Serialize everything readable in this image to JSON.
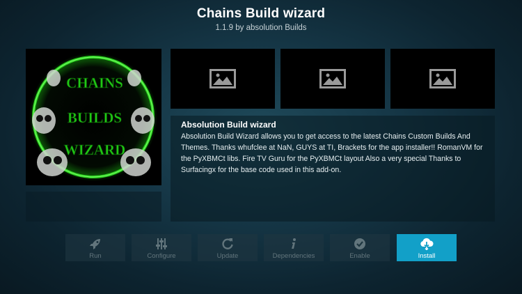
{
  "header": {
    "title": "Chains Build wizard",
    "subtitle": "1.1.9 by absolution Builds"
  },
  "addon_icon": {
    "icon": "chains-builds-wizard-logo",
    "lines": [
      "CHAINS",
      "BUILDS",
      "WIZARD"
    ],
    "accent": "#2bd81f"
  },
  "screenshots": [
    {
      "icon": "image-placeholder-icon"
    },
    {
      "icon": "image-placeholder-icon"
    },
    {
      "icon": "image-placeholder-icon"
    }
  ],
  "description": {
    "title": "Absolution Build wizard",
    "body": "Absolution Build Wizard allows you to get access to the latest Chains Custom Builds And Themes. Thanks whufclee at NaN, GUYS at TI, Brackets for the app installer!! RomanVM for the PyXBMCt libs. Fire TV Guru for the PyXBMCt layout Also a very special Thanks to Surfacingx for the base code used in this add-on."
  },
  "buttons": [
    {
      "label": "Run",
      "icon": "rocket-icon",
      "enabled": false
    },
    {
      "label": "Configure",
      "icon": "sliders-icon",
      "enabled": false
    },
    {
      "label": "Update",
      "icon": "refresh-icon",
      "enabled": false
    },
    {
      "label": "Dependencies",
      "icon": "info-icon",
      "enabled": false
    },
    {
      "label": "Enable",
      "icon": "check-circle-icon",
      "enabled": false
    },
    {
      "label": "Install",
      "icon": "cloud-download-icon",
      "enabled": true
    }
  ],
  "colors": {
    "install_active": "#12a0c8",
    "disabled_text": "#62757c",
    "background": "#163848"
  }
}
